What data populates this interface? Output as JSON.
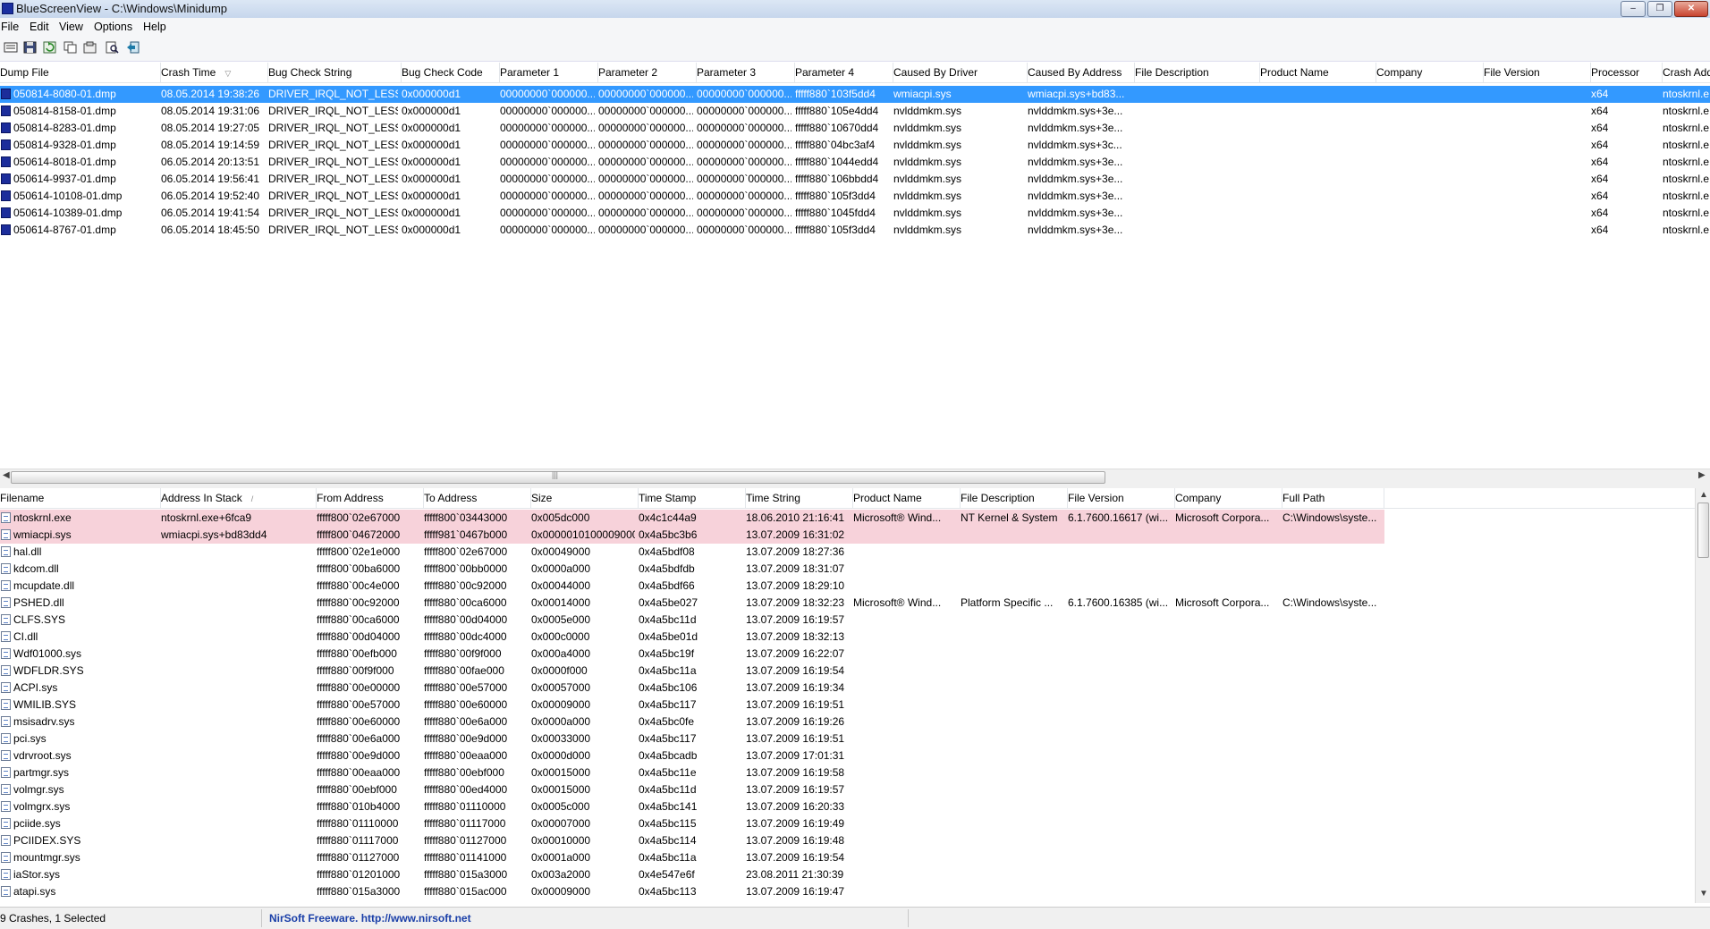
{
  "window": {
    "title": "BlueScreenView  -  C:\\Windows\\Minidump",
    "minimize": "–",
    "restore": "❐",
    "close": "✕"
  },
  "menu": [
    "File",
    "Edit",
    "View",
    "Options",
    "Help"
  ],
  "toolbar": [
    {
      "name": "save-selected-icon"
    },
    {
      "name": "save-icon"
    },
    {
      "name": "refresh-icon"
    },
    {
      "name": "copy-icon"
    },
    {
      "name": "properties-icon"
    },
    {
      "name": "find-icon"
    },
    {
      "name": "exit-icon"
    }
  ],
  "crashes": {
    "columns": [
      "Dump File",
      "Crash Time",
      "Bug Check String",
      "Bug Check Code",
      "Parameter 1",
      "Parameter 2",
      "Parameter 3",
      "Parameter 4",
      "Caused By Driver",
      "Caused By Address",
      "File Description",
      "Product Name",
      "Company",
      "File Version",
      "Processor",
      "Crash Add"
    ],
    "sort_indicator": "▽",
    "rows": [
      [
        "050814-8080-01.dmp",
        "08.05.2014 19:38:26",
        "DRIVER_IRQL_NOT_LESS...",
        "0x000000d1",
        "00000000`000000...",
        "00000000`000000...",
        "00000000`000000...",
        "fffff880`103f5dd4",
        "wmiacpi.sys",
        "wmiacpi.sys+bd83...",
        "",
        "",
        "",
        "",
        "x64",
        "ntoskrnl.e"
      ],
      [
        "050814-8158-01.dmp",
        "08.05.2014 19:31:06",
        "DRIVER_IRQL_NOT_LESS...",
        "0x000000d1",
        "00000000`000000...",
        "00000000`000000...",
        "00000000`000000...",
        "fffff880`105e4dd4",
        "nvlddmkm.sys",
        "nvlddmkm.sys+3e...",
        "",
        "",
        "",
        "",
        "x64",
        "ntoskrnl.e"
      ],
      [
        "050814-8283-01.dmp",
        "08.05.2014 19:27:05",
        "DRIVER_IRQL_NOT_LESS...",
        "0x000000d1",
        "00000000`000000...",
        "00000000`000000...",
        "00000000`000000...",
        "fffff880`10670dd4",
        "nvlddmkm.sys",
        "nvlddmkm.sys+3e...",
        "",
        "",
        "",
        "",
        "x64",
        "ntoskrnl.e"
      ],
      [
        "050814-9328-01.dmp",
        "08.05.2014 19:14:59",
        "DRIVER_IRQL_NOT_LESS...",
        "0x000000d1",
        "00000000`000000...",
        "00000000`000000...",
        "00000000`000000...",
        "fffff880`04bc3af4",
        "nvlddmkm.sys",
        "nvlddmkm.sys+3c...",
        "",
        "",
        "",
        "",
        "x64",
        "ntoskrnl.e"
      ],
      [
        "050614-8018-01.dmp",
        "06.05.2014 20:13:51",
        "DRIVER_IRQL_NOT_LESS...",
        "0x000000d1",
        "00000000`000000...",
        "00000000`000000...",
        "00000000`000000...",
        "fffff880`1044edd4",
        "nvlddmkm.sys",
        "nvlddmkm.sys+3e...",
        "",
        "",
        "",
        "",
        "x64",
        "ntoskrnl.e"
      ],
      [
        "050614-9937-01.dmp",
        "06.05.2014 19:56:41",
        "DRIVER_IRQL_NOT_LESS...",
        "0x000000d1",
        "00000000`000000...",
        "00000000`000000...",
        "00000000`000000...",
        "fffff880`106bbdd4",
        "nvlddmkm.sys",
        "nvlddmkm.sys+3e...",
        "",
        "",
        "",
        "",
        "x64",
        "ntoskrnl.e"
      ],
      [
        "050614-10108-01.dmp",
        "06.05.2014 19:52:40",
        "DRIVER_IRQL_NOT_LESS...",
        "0x000000d1",
        "00000000`000000...",
        "00000000`000000...",
        "00000000`000000...",
        "fffff880`105f3dd4",
        "nvlddmkm.sys",
        "nvlddmkm.sys+3e...",
        "",
        "",
        "",
        "",
        "x64",
        "ntoskrnl.e"
      ],
      [
        "050614-10389-01.dmp",
        "06.05.2014 19:41:54",
        "DRIVER_IRQL_NOT_LESS...",
        "0x000000d1",
        "00000000`000000...",
        "00000000`000000...",
        "00000000`000000...",
        "fffff880`1045fdd4",
        "nvlddmkm.sys",
        "nvlddmkm.sys+3e...",
        "",
        "",
        "",
        "",
        "x64",
        "ntoskrnl.e"
      ],
      [
        "050614-8767-01.dmp",
        "06.05.2014 18:45:50",
        "DRIVER_IRQL_NOT_LESS...",
        "0x000000d1",
        "00000000`000000...",
        "00000000`000000...",
        "00000000`000000...",
        "fffff880`105f3dd4",
        "nvlddmkm.sys",
        "nvlddmkm.sys+3e...",
        "",
        "",
        "",
        "",
        "x64",
        "ntoskrnl.e"
      ]
    ]
  },
  "drivers": {
    "columns": [
      "Filename",
      "Address In Stack",
      "From Address",
      "To Address",
      "Size",
      "Time Stamp",
      "Time String",
      "Product Name",
      "File Description",
      "File Version",
      "Company",
      "Full Path"
    ],
    "sort_indicator": "/",
    "rows": [
      [
        "ntoskrnl.exe",
        "ntoskrnl.exe+6fca9",
        "fffff800`02e67000",
        "fffff800`03443000",
        "0x005dc000",
        "0x4c1c44a9",
        "18.06.2010 21:16:41",
        "Microsoft® Wind...",
        "NT Kernel & System",
        "6.1.7600.16617 (wi...",
        "Microsoft Corpora...",
        "C:\\Windows\\syste..."
      ],
      [
        "wmiacpi.sys",
        "wmiacpi.sys+bd83dd4",
        "fffff800`04672000",
        "fffff981`0467b000",
        "0x0000010100009000",
        "0x4a5bc3b6",
        "13.07.2009 16:31:02",
        "",
        "",
        "",
        "",
        ""
      ],
      [
        "hal.dll",
        "",
        "fffff800`02e1e000",
        "fffff800`02e67000",
        "0x00049000",
        "0x4a5bdf08",
        "13.07.2009 18:27:36",
        "",
        "",
        "",
        "",
        ""
      ],
      [
        "kdcom.dll",
        "",
        "fffff800`00ba6000",
        "fffff800`00bb0000",
        "0x0000a000",
        "0x4a5bdfdb",
        "13.07.2009 18:31:07",
        "",
        "",
        "",
        "",
        ""
      ],
      [
        "mcupdate.dll",
        "",
        "fffff880`00c4e000",
        "fffff880`00c92000",
        "0x00044000",
        "0x4a5bdf66",
        "13.07.2009 18:29:10",
        "",
        "",
        "",
        "",
        ""
      ],
      [
        "PSHED.dll",
        "",
        "fffff880`00c92000",
        "fffff880`00ca6000",
        "0x00014000",
        "0x4a5be027",
        "13.07.2009 18:32:23",
        "Microsoft® Wind...",
        "Platform Specific ...",
        "6.1.7600.16385 (wi...",
        "Microsoft Corpora...",
        "C:\\Windows\\syste..."
      ],
      [
        "CLFS.SYS",
        "",
        "fffff880`00ca6000",
        "fffff880`00d04000",
        "0x0005e000",
        "0x4a5bc11d",
        "13.07.2009 16:19:57",
        "",
        "",
        "",
        "",
        ""
      ],
      [
        "CI.dll",
        "",
        "fffff880`00d04000",
        "fffff880`00dc4000",
        "0x000c0000",
        "0x4a5be01d",
        "13.07.2009 18:32:13",
        "",
        "",
        "",
        "",
        ""
      ],
      [
        "Wdf01000.sys",
        "",
        "fffff880`00efb000",
        "fffff880`00f9f000",
        "0x000a4000",
        "0x4a5bc19f",
        "13.07.2009 16:22:07",
        "",
        "",
        "",
        "",
        ""
      ],
      [
        "WDFLDR.SYS",
        "",
        "fffff880`00f9f000",
        "fffff880`00fae000",
        "0x0000f000",
        "0x4a5bc11a",
        "13.07.2009 16:19:54",
        "",
        "",
        "",
        "",
        ""
      ],
      [
        "ACPI.sys",
        "",
        "fffff880`00e00000",
        "fffff880`00e57000",
        "0x00057000",
        "0x4a5bc106",
        "13.07.2009 16:19:34",
        "",
        "",
        "",
        "",
        ""
      ],
      [
        "WMILIB.SYS",
        "",
        "fffff880`00e57000",
        "fffff880`00e60000",
        "0x00009000",
        "0x4a5bc117",
        "13.07.2009 16:19:51",
        "",
        "",
        "",
        "",
        ""
      ],
      [
        "msisadrv.sys",
        "",
        "fffff880`00e60000",
        "fffff880`00e6a000",
        "0x0000a000",
        "0x4a5bc0fe",
        "13.07.2009 16:19:26",
        "",
        "",
        "",
        "",
        ""
      ],
      [
        "pci.sys",
        "",
        "fffff880`00e6a000",
        "fffff880`00e9d000",
        "0x00033000",
        "0x4a5bc117",
        "13.07.2009 16:19:51",
        "",
        "",
        "",
        "",
        ""
      ],
      [
        "vdrvroot.sys",
        "",
        "fffff880`00e9d000",
        "fffff880`00eaa000",
        "0x0000d000",
        "0x4a5bcadb",
        "13.07.2009 17:01:31",
        "",
        "",
        "",
        "",
        ""
      ],
      [
        "partmgr.sys",
        "",
        "fffff880`00eaa000",
        "fffff880`00ebf000",
        "0x00015000",
        "0x4a5bc11e",
        "13.07.2009 16:19:58",
        "",
        "",
        "",
        "",
        ""
      ],
      [
        "volmgr.sys",
        "",
        "fffff880`00ebf000",
        "fffff880`00ed4000",
        "0x00015000",
        "0x4a5bc11d",
        "13.07.2009 16:19:57",
        "",
        "",
        "",
        "",
        ""
      ],
      [
        "volmgrx.sys",
        "",
        "fffff880`010b4000",
        "fffff880`01110000",
        "0x0005c000",
        "0x4a5bc141",
        "13.07.2009 16:20:33",
        "",
        "",
        "",
        "",
        ""
      ],
      [
        "pciide.sys",
        "",
        "fffff880`01110000",
        "fffff880`01117000",
        "0x00007000",
        "0x4a5bc115",
        "13.07.2009 16:19:49",
        "",
        "",
        "",
        "",
        ""
      ],
      [
        "PCIIDEX.SYS",
        "",
        "fffff880`01117000",
        "fffff880`01127000",
        "0x00010000",
        "0x4a5bc114",
        "13.07.2009 16:19:48",
        "",
        "",
        "",
        "",
        ""
      ],
      [
        "mountmgr.sys",
        "",
        "fffff880`01127000",
        "fffff880`01141000",
        "0x0001a000",
        "0x4a5bc11a",
        "13.07.2009 16:19:54",
        "",
        "",
        "",
        "",
        ""
      ],
      [
        "iaStor.sys",
        "",
        "fffff880`01201000",
        "fffff880`015a3000",
        "0x003a2000",
        "0x4e547e6f",
        "23.08.2011 21:30:39",
        "",
        "",
        "",
        "",
        ""
      ],
      [
        "atapi.sys",
        "",
        "fffff880`015a3000",
        "fffff880`015ac000",
        "0x00009000",
        "0x4a5bc113",
        "13.07.2009 16:19:47",
        "",
        "",
        "",
        "",
        ""
      ]
    ]
  },
  "status": {
    "count": "9 Crashes, 1 Selected",
    "freeware": "NirSoft Freeware.  http://www.nirsoft.net"
  },
  "colors": {
    "selected_row": "#3399ff",
    "highlight_row": "#f7d2da",
    "link": "#1a3fa8"
  }
}
